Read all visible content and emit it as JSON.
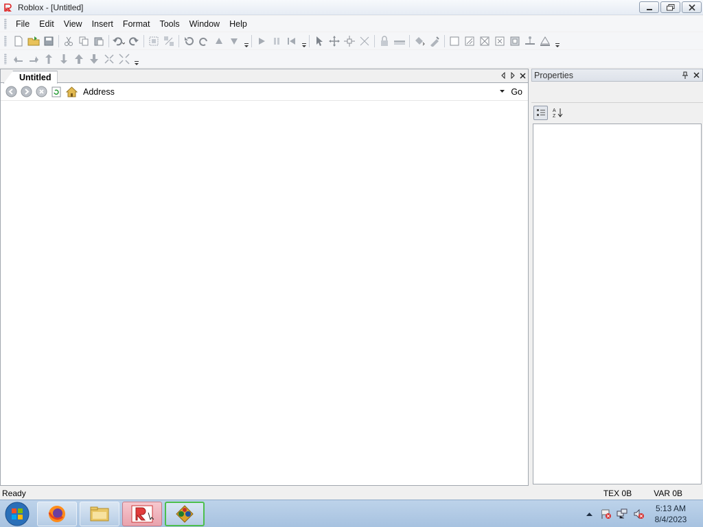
{
  "window": {
    "title": "Roblox - [Untitled]",
    "icon": "roblox-logo-icon",
    "controls": [
      "minimize-icon",
      "restore-icon",
      "close-icon"
    ]
  },
  "menu": {
    "items": [
      "File",
      "Edit",
      "View",
      "Insert",
      "Format",
      "Tools",
      "Window",
      "Help"
    ]
  },
  "toolbar1": {
    "icons": [
      "new-file-icon",
      "open-folder-icon",
      "save-icon",
      "cut-icon",
      "copy-icon",
      "paste-icon",
      "undo-icon",
      "redo-icon",
      "group-icon",
      "ungroup-icon",
      "rotate-left-icon",
      "tilt-icon",
      "move-up-icon",
      "move-down-icon",
      "play-icon",
      "pause-icon",
      "reset-icon",
      "select-icon",
      "move-icon",
      "resize-icon",
      "axis-icon",
      "lock-icon",
      "anchor-icon",
      "paint-bucket-icon",
      "material-icon",
      "surface-smooth-icon",
      "surface-glue-icon",
      "surface-weld-icon",
      "surface-studs-icon",
      "surface-inlet-icon",
      "surface-hinge-icon",
      "surface-motor-icon"
    ]
  },
  "toolbar2": {
    "icons": [
      "camera-left-icon",
      "camera-right-icon",
      "camera-up-icon",
      "camera-down-icon",
      "camera-forward-icon",
      "camera-back-icon",
      "zoom-in-icon",
      "zoom-out-icon"
    ]
  },
  "document": {
    "tab_label": "Untitled",
    "address_label": "Address",
    "address_value": "",
    "go_label": "Go"
  },
  "properties": {
    "title": "Properties"
  },
  "status": {
    "text": "Ready",
    "tex": "TEX 0B",
    "var": "VAR 0B"
  },
  "taskbar": {
    "apps": [
      "firefox-icon",
      "file-explorer-icon",
      "roblox-icon",
      "roblox-studio-icon"
    ],
    "time": "5:13 AM",
    "date": "8/4/2023"
  }
}
